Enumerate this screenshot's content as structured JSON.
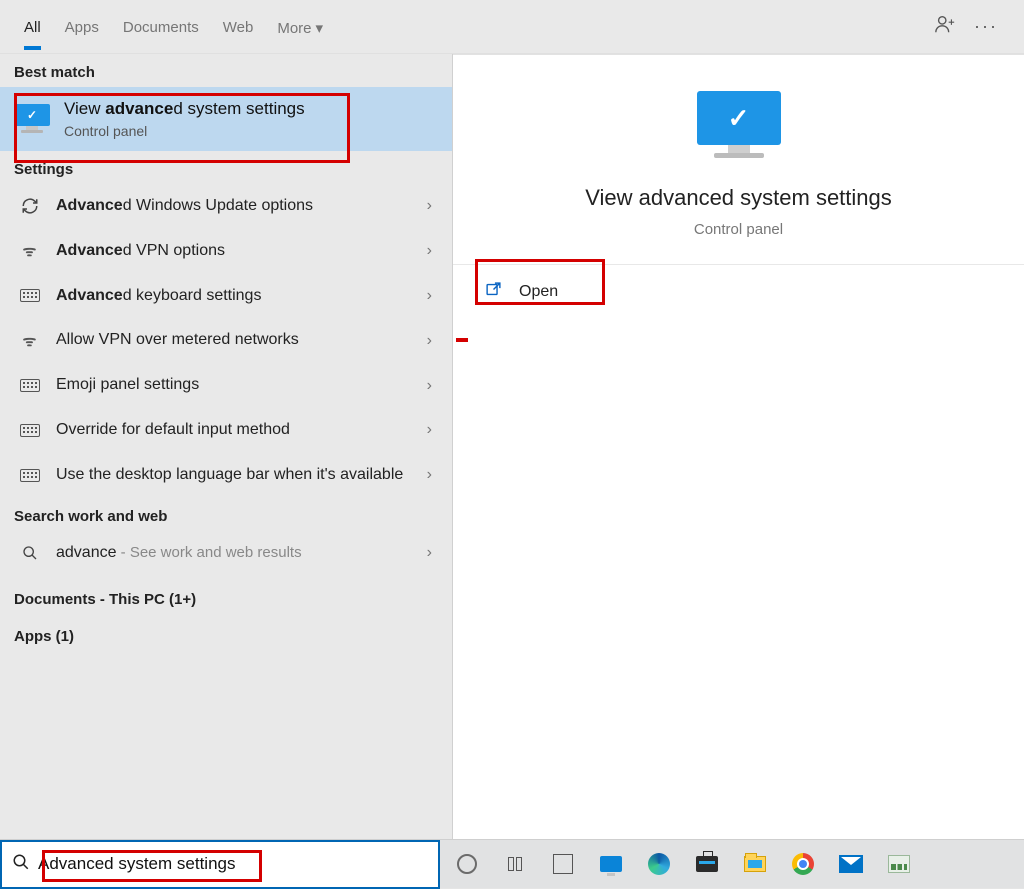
{
  "tabs": {
    "all": "All",
    "apps": "Apps",
    "documents": "Documents",
    "web": "Web",
    "more": "More"
  },
  "sections": {
    "best_match": "Best match",
    "settings": "Settings",
    "search_work_web": "Search work and web",
    "documents_header": "Documents - This PC (1+)",
    "apps_header": "Apps (1)"
  },
  "best_match": {
    "title_prefix": "View ",
    "title_bold": "advance",
    "title_rest": "d system settings",
    "subtitle": "Control panel"
  },
  "settings_items": [
    {
      "icon": "refresh",
      "bold": "Advance",
      "rest": "d Windows Update options"
    },
    {
      "icon": "vpn",
      "bold": "Advance",
      "rest": "d VPN options"
    },
    {
      "icon": "keyboard",
      "bold": "Advance",
      "rest": "d keyboard settings"
    },
    {
      "icon": "vpn",
      "bold": "",
      "rest": "Allow VPN over metered networks"
    },
    {
      "icon": "keyboard",
      "bold": "",
      "rest": "Emoji panel settings"
    },
    {
      "icon": "keyboard",
      "bold": "",
      "rest": "Override for default input method"
    },
    {
      "icon": "keyboard",
      "bold": "",
      "rest": "Use the desktop language bar when it's available"
    }
  ],
  "web_search": {
    "term": "advance",
    "suffix": " - See work and web results"
  },
  "preview": {
    "title": "View advanced system settings",
    "subtitle": "Control panel",
    "open": "Open"
  },
  "searchbox": {
    "value": "Advanced system settings"
  }
}
